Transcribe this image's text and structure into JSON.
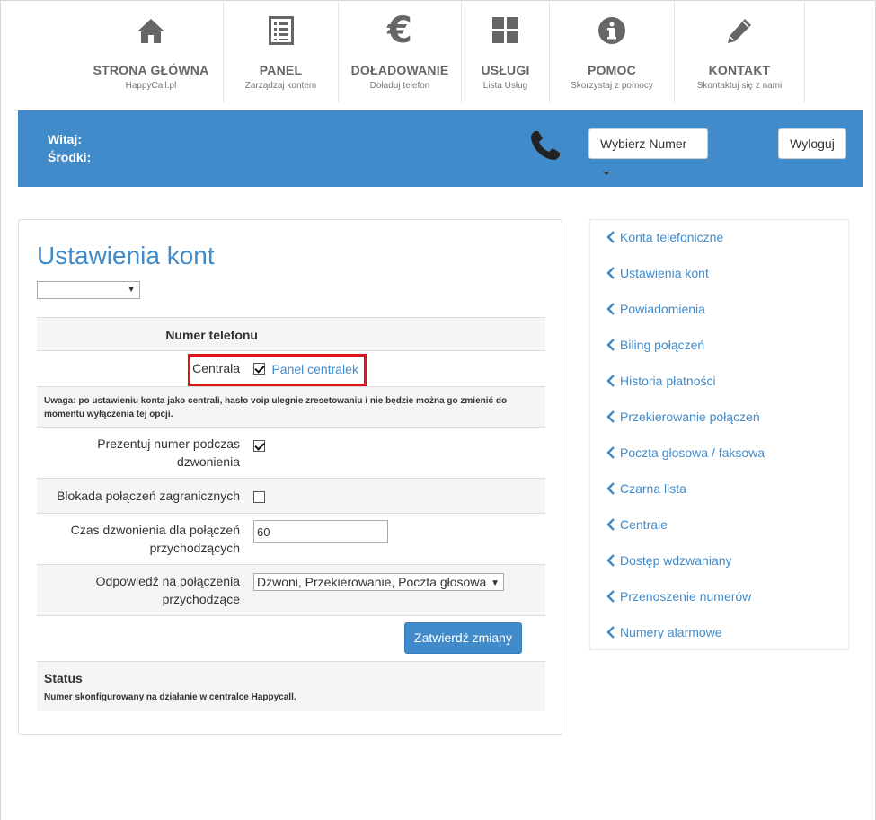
{
  "nav": [
    {
      "title": "STRONA GŁÓWNA",
      "sub": "HappyCall.pl",
      "icon": "home-icon"
    },
    {
      "title": "PANEL",
      "sub": "Zarządzaj kontem",
      "icon": "list-icon"
    },
    {
      "title": "DOŁADOWANIE",
      "sub": "Doładuj telefon",
      "icon": "euro-icon"
    },
    {
      "title": "USŁUGI",
      "sub": "Lista Usług",
      "icon": "grid-icon"
    },
    {
      "title": "POMOC",
      "sub": "Skorzystaj z pomocy",
      "icon": "info-icon"
    },
    {
      "title": "KONTAKT",
      "sub": "Skontaktuj się z nami",
      "icon": "pencil-icon"
    }
  ],
  "header": {
    "welcome_label": "Witaj:",
    "funds_label": "Środki:",
    "select_number_label": "Wybierz Numer",
    "logout_label": "Wyloguj",
    "phone_icon": "phone-icon"
  },
  "main": {
    "title": "Ustawienia kont",
    "account_select_value": "",
    "phone_number_header": "Numer telefonu",
    "centrala_label": "Centrala",
    "centrala_checked": true,
    "centrala_link": "Panel centralek",
    "warning": "Uwaga: po ustawieniu konta jako centrali, hasło voip ulegnie zresetowaniu i nie będzie można go zmienić do momentu wyłączenia tej opcji.",
    "present_number_label_1": "Prezentuj numer podczas",
    "present_number_label_2": "dzwonienia",
    "present_number_checked": true,
    "block_intl_label": "Blokada połączeń zagranicznych",
    "block_intl_checked": false,
    "ring_time_label_1": "Czas dzwonienia dla połączeń",
    "ring_time_label_2": "przychodzących",
    "ring_time_value": "60",
    "answer_label_1": "Odpowiedź na połączenia",
    "answer_label_2": "przychodzące",
    "answer_value": "Dzwoni, Przekierowanie, Poczta głosowa",
    "submit_label": "Zatwierdź zmiany",
    "status_title": "Status",
    "status_text": "Numer skonfigurowany na działanie w centralce Happycall."
  },
  "sidebar": {
    "items": [
      {
        "label": "Konta telefoniczne"
      },
      {
        "label": "Ustawienia kont"
      },
      {
        "label": "Powiadomienia"
      },
      {
        "label": "Biling połączeń"
      },
      {
        "label": "Historia płatności"
      },
      {
        "label": "Przekierowanie połączeń"
      },
      {
        "label": "Poczta głosowa / faksowa"
      },
      {
        "label": "Czarna lista"
      },
      {
        "label": "Centrale"
      },
      {
        "label": "Dostęp wdzwaniany"
      },
      {
        "label": "Przenoszenie numerów"
      },
      {
        "label": "Numery alarmowe"
      }
    ]
  },
  "colors": {
    "accent": "#428bca",
    "highlight": "#e0141c",
    "icon_gray": "#666666"
  }
}
